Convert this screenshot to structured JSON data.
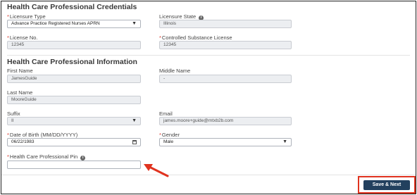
{
  "credentials": {
    "title": "Health Care Professional Credentials",
    "licensure_type": {
      "label": "Licensure Type",
      "required": true,
      "value": "Advance Practice Registered Nurses APRN"
    },
    "licensure_state": {
      "label": "Licensure State",
      "value": "Illinois"
    },
    "license_no": {
      "label": "License No.",
      "required": true,
      "value": "12345"
    },
    "controlled_substance_license": {
      "label": "Controlled Substance License",
      "required": true,
      "value": "12345"
    }
  },
  "information": {
    "title": "Health Care Professional Information",
    "first_name": {
      "label": "First Name",
      "value": "JamesGuide"
    },
    "middle_name": {
      "label": "Middle Name",
      "value": "-"
    },
    "last_name": {
      "label": "Last Name",
      "value": "MooreGuide"
    },
    "suffix": {
      "label": "Suffix",
      "value": "II"
    },
    "email": {
      "label": "Email",
      "value": "james.moore+guide@mtxb2b.com"
    },
    "dob": {
      "label": "Date of Birth (MM/DD/YYYY)",
      "required": true,
      "value": "06/22/1983"
    },
    "gender": {
      "label": "Gender",
      "required": true,
      "value": "Male"
    },
    "pin": {
      "label": "Health Care Professional Pin",
      "required": true,
      "value": ""
    }
  },
  "actions": {
    "save_next_label": "Save & Next"
  },
  "colors": {
    "required": "#d9362b",
    "primary_button": "#22405e",
    "highlight": "#e0331f"
  },
  "icons": {
    "info": "info-icon",
    "dropdown": "chevron-down-icon",
    "calendar": "calendar-icon",
    "annotation": "red-arrow-annotation"
  }
}
